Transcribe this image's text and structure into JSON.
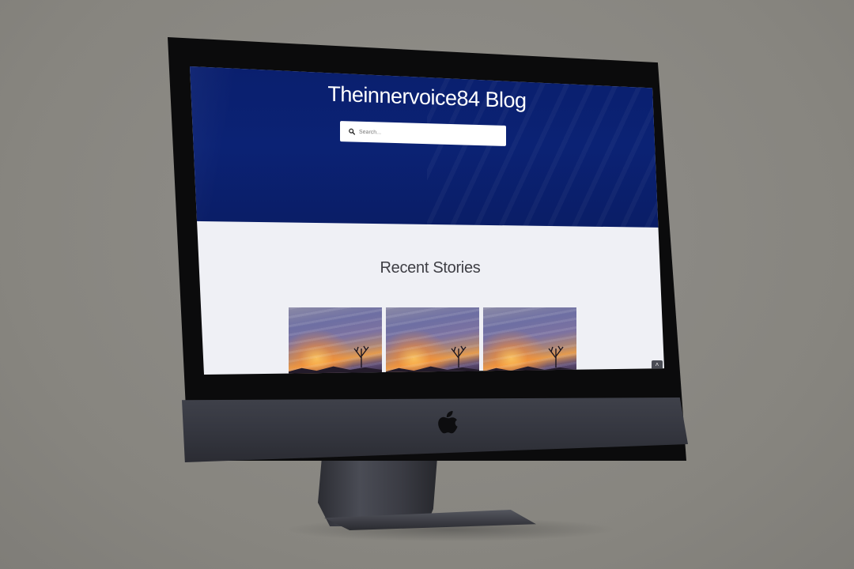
{
  "site": {
    "title": "Theinnervoice84 Blog"
  },
  "search": {
    "placeholder": "Search..."
  },
  "recent": {
    "heading": "Recent Stories",
    "stories": [
      {
        "image": "sunset-photo"
      },
      {
        "image": "sunset-photo"
      },
      {
        "image": "sunset-photo"
      }
    ]
  },
  "icons": {
    "search": "search-icon",
    "scroll_top": "chevron-up-icon",
    "brand": "apple-logo-icon"
  },
  "colors": {
    "hero": "#0b2274",
    "page_background": "#eff0f5",
    "title_text": "#ffffff",
    "heading_text": "#3e3e44"
  }
}
